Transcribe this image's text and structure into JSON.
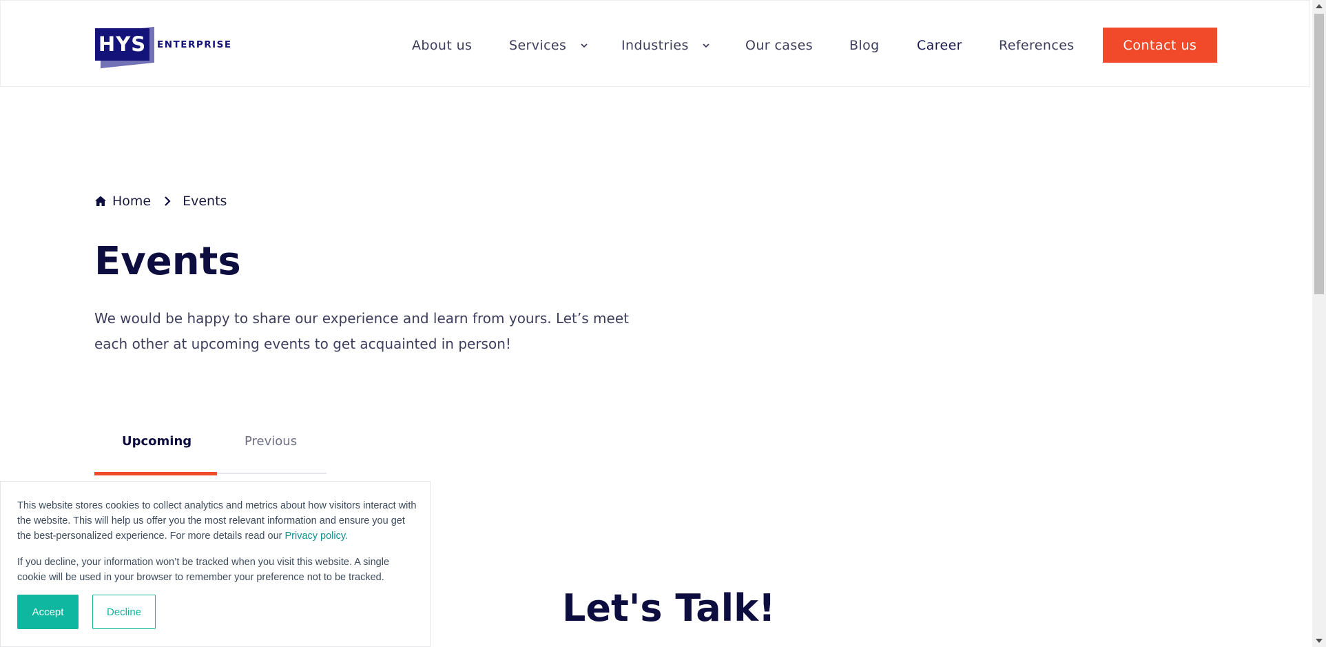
{
  "header": {
    "logo": {
      "mark": "HYS",
      "suffix": "ENTERPRISE"
    },
    "nav": [
      {
        "label": "About us"
      },
      {
        "label": "Services",
        "has_dropdown": true
      },
      {
        "label": "Industries",
        "has_dropdown": true
      },
      {
        "label": "Our cases"
      },
      {
        "label": "Blog"
      },
      {
        "label": "Career"
      },
      {
        "label": "References"
      }
    ],
    "contact_label": "Contact us"
  },
  "breadcrumb": {
    "home_icon": "home-icon",
    "items": [
      "Home",
      "Events"
    ]
  },
  "main": {
    "title": "Events",
    "intro": "We would be happy to share our experience and learn from yours. Let’s meet each other at upcoming events to get acquainted in person!",
    "tabs": [
      {
        "label": "Upcoming",
        "active": true
      },
      {
        "label": "Previous",
        "active": false
      }
    ],
    "cta_title": "Let's Talk!"
  },
  "cookie_banner": {
    "text_1": "This website stores cookies to collect analytics and metrics about how visitors interact with the website. This will help us offer you the most relevant information and ensure you get the best-personalized experience. For more details read our ",
    "privacy_link": "Privacy policy.",
    "text_2": "If you decline, your information won’t be tracked when you visit this website. A single cookie will be used in your browser to remember your preference not to be tracked.",
    "accept_label": "Accept",
    "decline_label": "Decline"
  },
  "colors": {
    "brand_navy": "#14137a",
    "accent_orange": "#f04a2b",
    "cookie_teal": "#0fb6a0"
  }
}
